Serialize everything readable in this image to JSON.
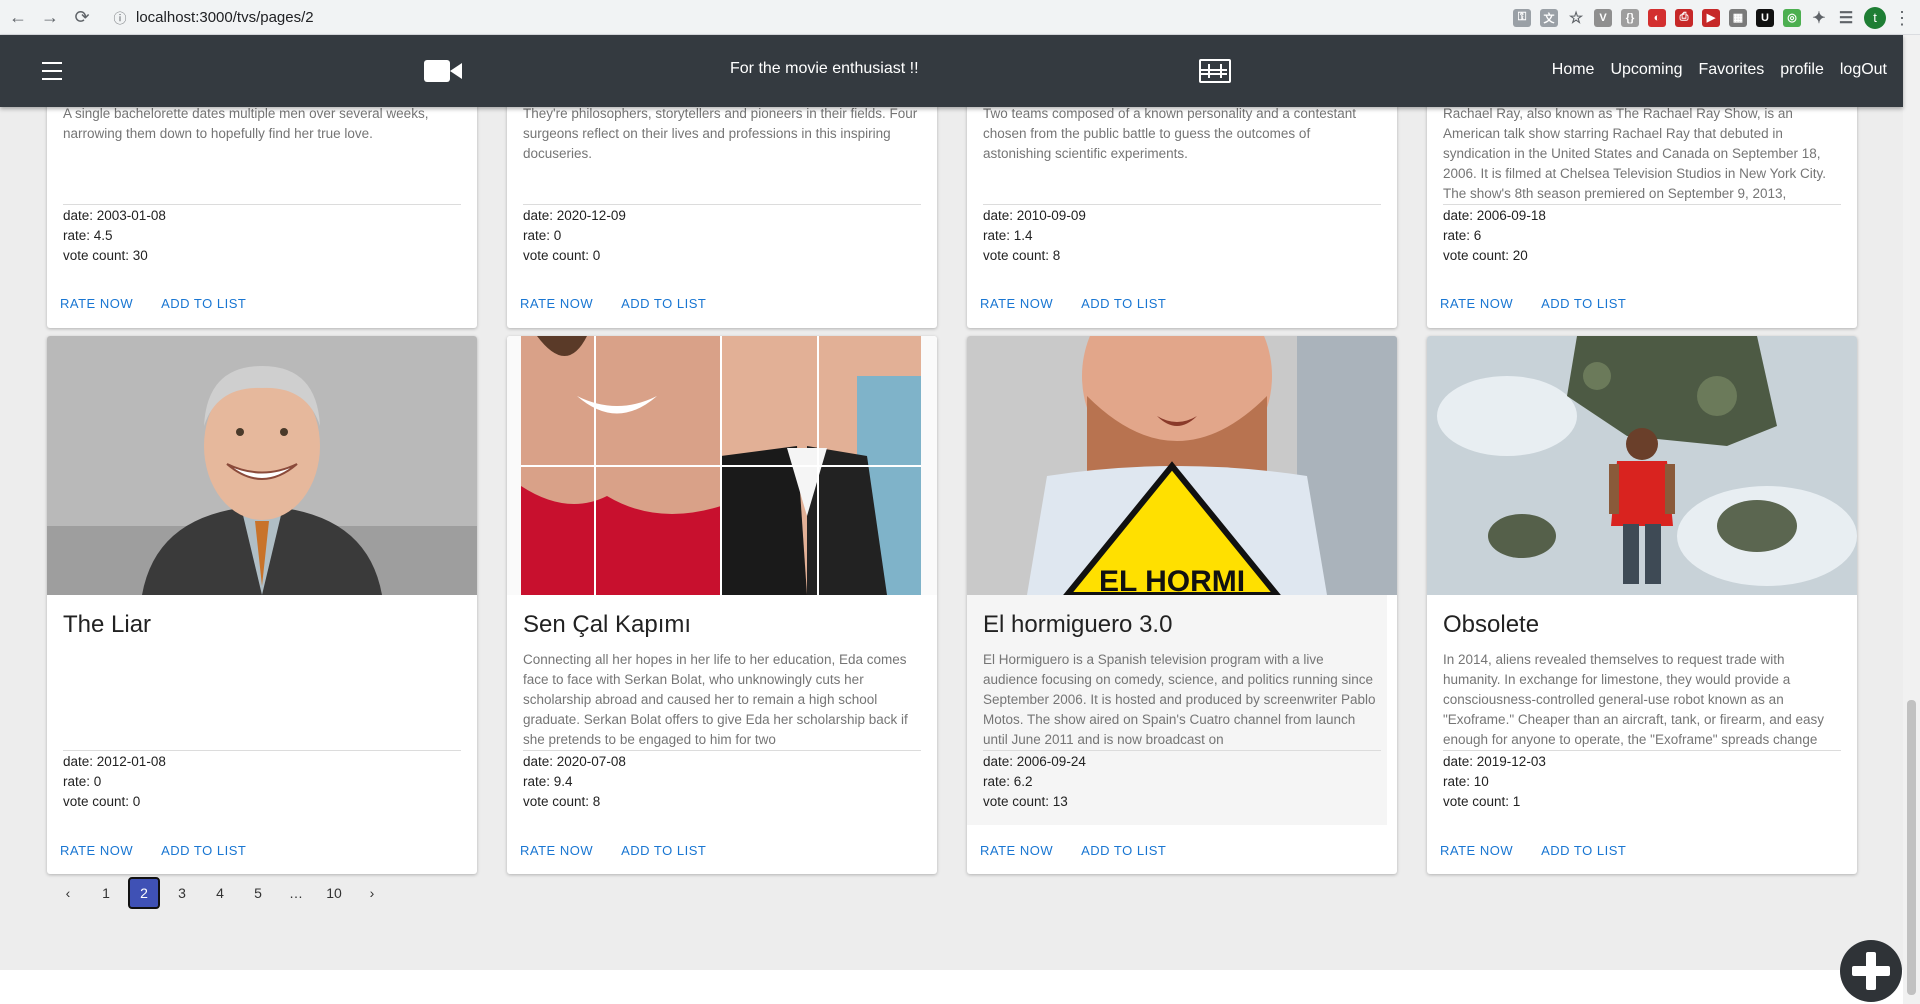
{
  "browser": {
    "url": "localhost:3000/tvs/pages/2",
    "avatar_letter": "t"
  },
  "header": {
    "tagline": "For the movie enthusiast !!",
    "nav": [
      "Home",
      "Upcoming",
      "Favorites",
      "profile",
      "logOut"
    ]
  },
  "labels": {
    "rate_now": "RATE NOW",
    "add_to_list": "ADD TO LIST"
  },
  "top_cards": [
    {
      "description": "A single bachelorette dates multiple men over several weeks, narrowing them down to hopefully find her true love.",
      "date": "date: 2003-01-08",
      "rate": "rate: 4.5",
      "votes": "vote count: 30"
    },
    {
      "description": "They're philosophers, storytellers and pioneers in their fields. Four surgeons reflect on their lives and professions in this inspiring docuseries.",
      "date": "date: 2020-12-09",
      "rate": "rate: 0",
      "votes": "vote count: 0"
    },
    {
      "description": "Two teams composed of a known personality and a contestant chosen from the public battle to guess the outcomes of astonishing scientific experiments.",
      "date": "date: 2010-09-09",
      "rate": "rate: 1.4",
      "votes": "vote count: 8"
    },
    {
      "description": "Rachael Ray, also known as The Rachael Ray Show, is an American talk show starring Rachael Ray that debuted in syndication in the United States and Canada on September 18, 2006. It is filmed at Chelsea Television Studios in New York City. The show's 8th season premiered on September 9, 2013,",
      "date": "date: 2006-09-18",
      "rate": "rate: 6",
      "votes": "vote count: 20"
    }
  ],
  "bottom_cards": [
    {
      "title": "The Liar",
      "description": "",
      "date": "date: 2012-01-08",
      "rate": "rate: 0",
      "votes": "vote count: 0"
    },
    {
      "title": "Sen Çal Kapımı",
      "description": "Connecting all her hopes in her life to her education, Eda comes face to face with Serkan Bolat, who unknowingly cuts her scholarship abroad and caused her to remain a high school graduate. Serkan Bolat offers to give Eda her scholarship back if she pretends to be engaged to him for two",
      "date": "date: 2020-07-08",
      "rate": "rate: 9.4",
      "votes": "vote count: 8"
    },
    {
      "title": "El hormiguero 3.0",
      "description": "El Hormiguero is a Spanish television program with a live audience focusing on comedy, science, and politics running since September 2006. It is hosted and produced by screenwriter Pablo Motos. The show aired on Spain's Cuatro channel from launch until June 2011 and is now broadcast on",
      "date": "date: 2006-09-24",
      "rate": "rate: 6.2",
      "votes": "vote count: 13"
    },
    {
      "title": "Obsolete",
      "description": "In 2014, aliens revealed themselves to request trade with humanity. In exchange for limestone, they would provide a consciousness-controlled general-use robot known as an \"Exoframe.\" Cheaper than an aircraft, tank, or firearm, and easy enough for anyone to operate, the \"Exoframe\" spreads change",
      "date": "date: 2019-12-03",
      "rate": "rate: 10",
      "votes": "vote count: 1"
    }
  ],
  "poster_text": {
    "hormiguero_sign": "EL HORMI"
  },
  "pagination": {
    "prev": "‹",
    "pages": [
      "1",
      "2",
      "3",
      "4",
      "5",
      "…",
      "10"
    ],
    "next": "›",
    "active": "2"
  },
  "colors": {
    "appbar": "#343a40",
    "accent": "#1976d2",
    "pagination_active": "#3f51b5"
  }
}
